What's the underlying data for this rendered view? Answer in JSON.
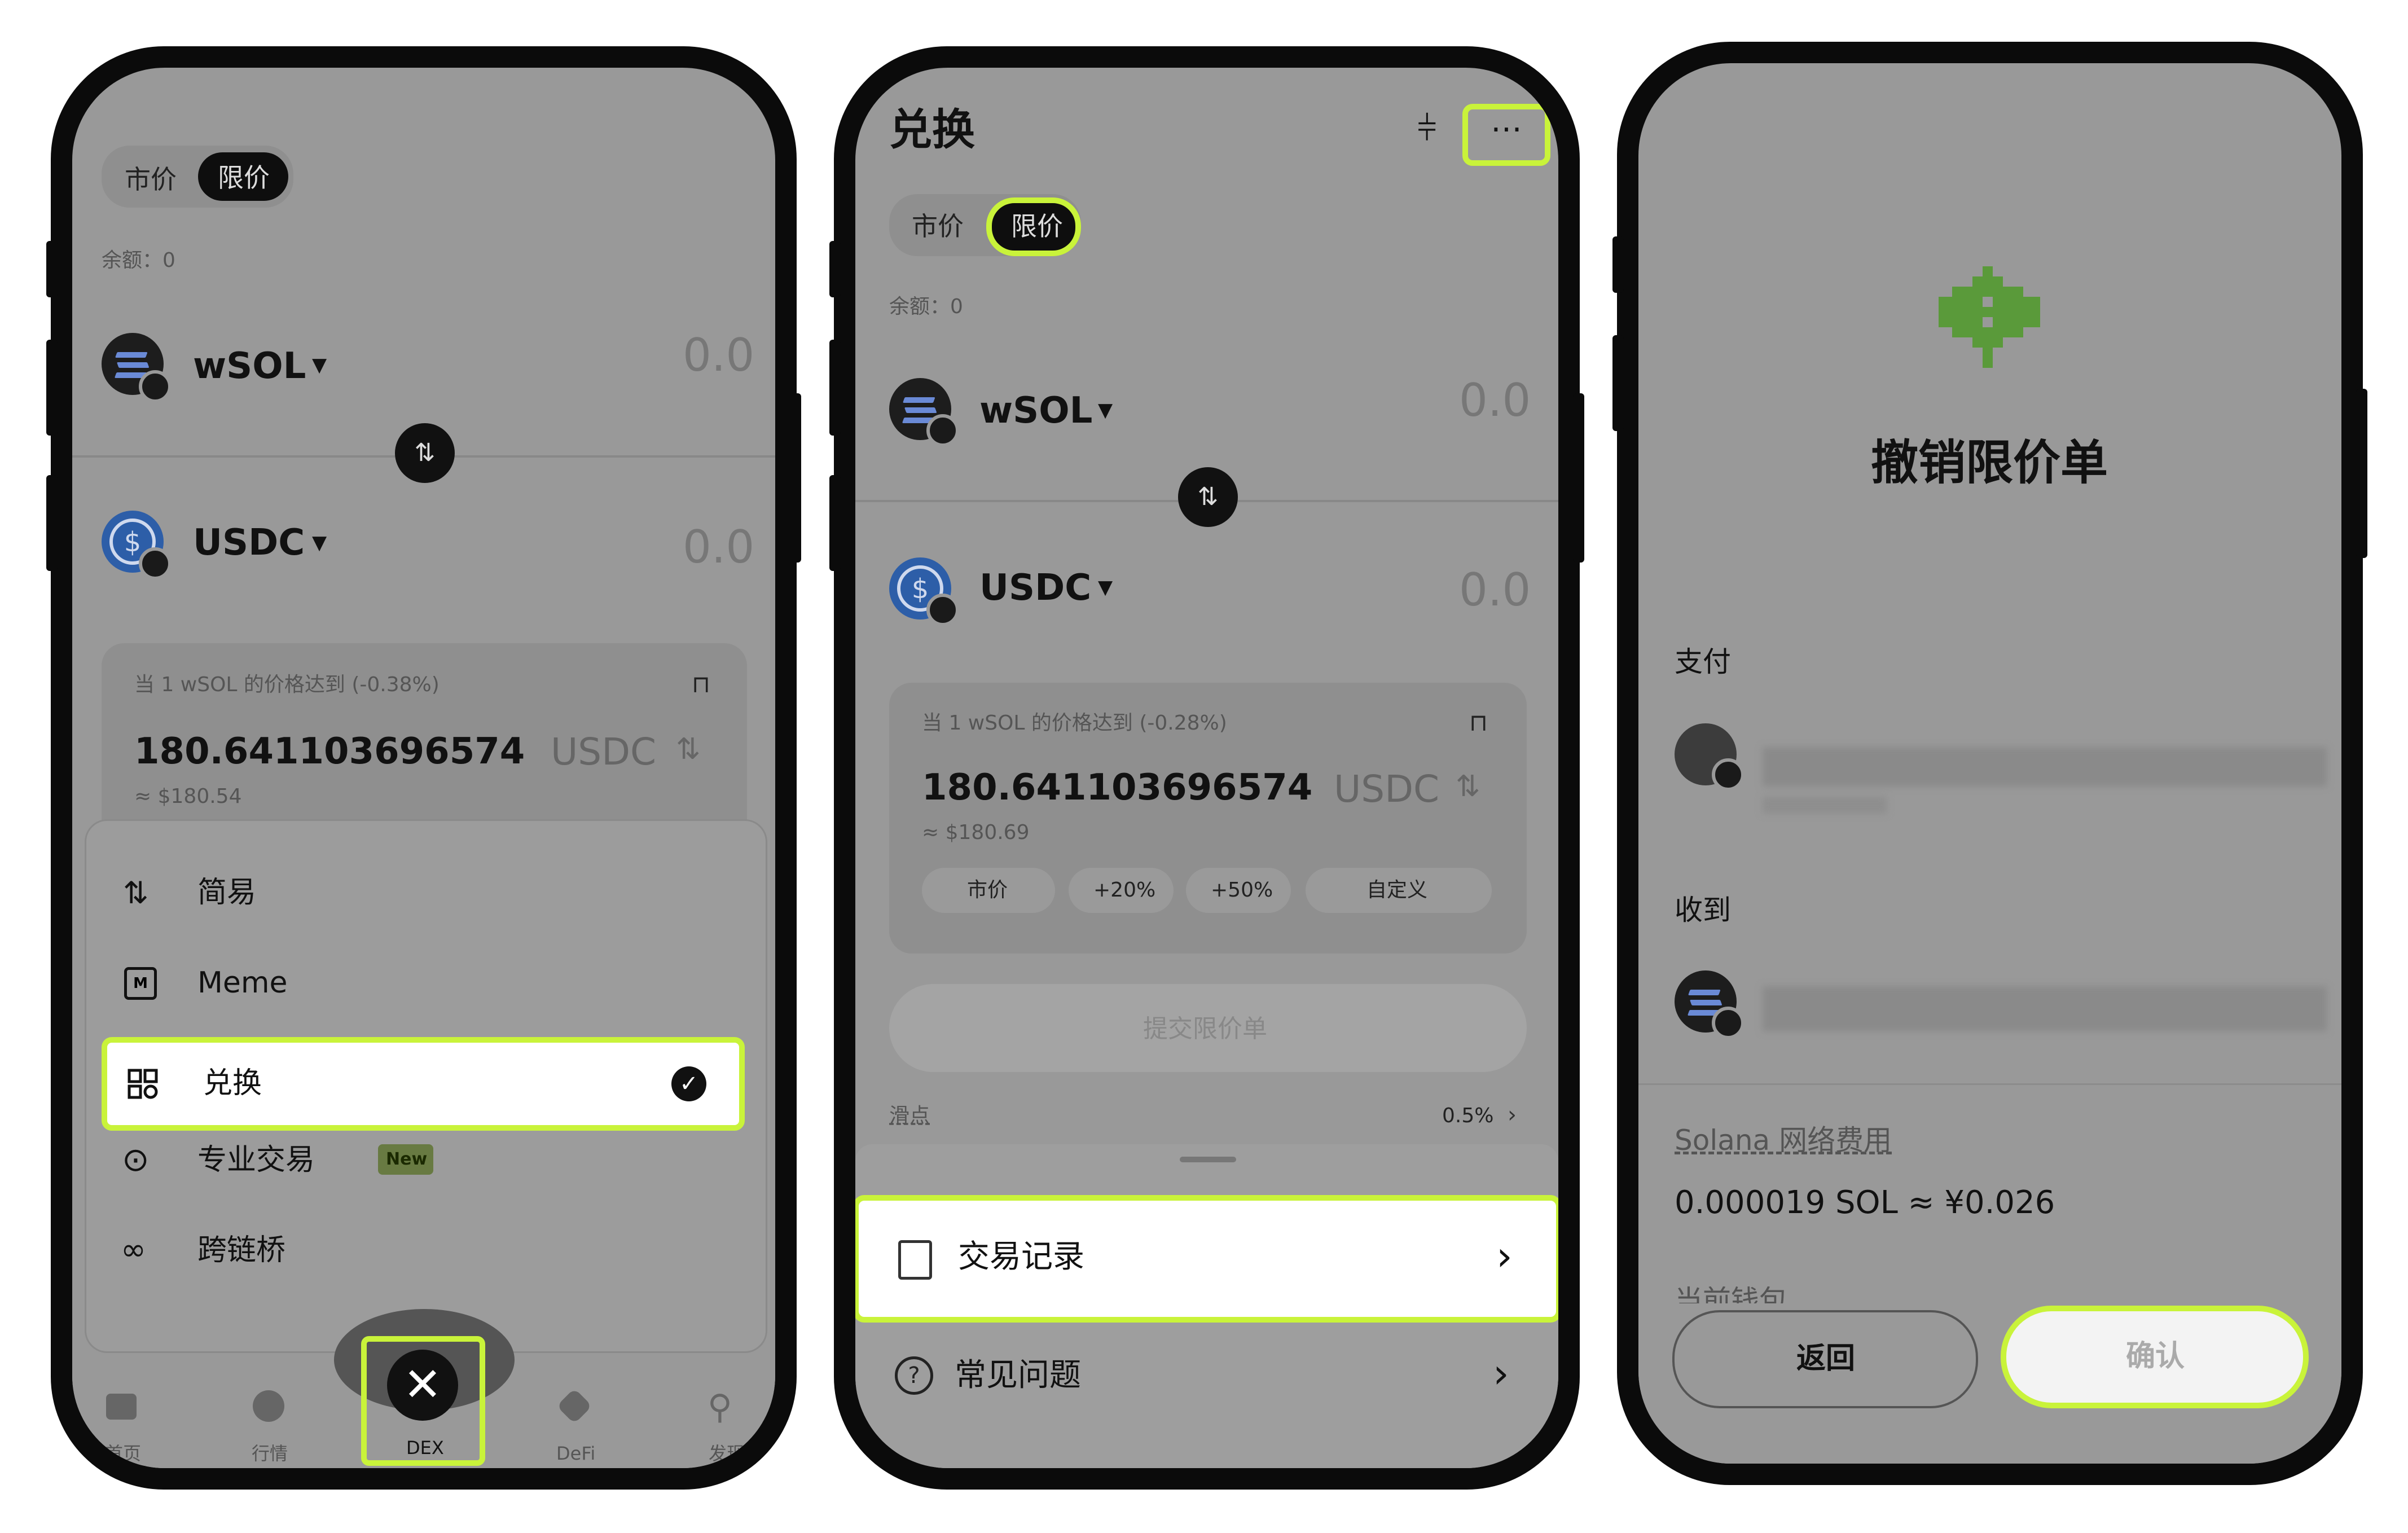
{
  "phone1": {
    "tabs": [
      "市价",
      "限价"
    ],
    "balance": "余额：0",
    "from_token": {
      "symbol": "wSOL",
      "amount": "0.0"
    },
    "to_token": {
      "symbol": "USDC",
      "amount": "0.0"
    },
    "price_condition": "当 1 wSOL 的价格达到 (-0.38%)",
    "price_value": "180.641103696574",
    "price_unit": "USDC",
    "price_fiat": "≈ $180.54",
    "menu": [
      {
        "icon": "simple-arrows-icon",
        "label": "简易"
      },
      {
        "icon": "meme-icon",
        "label": "Meme"
      },
      {
        "icon": "swap-icon",
        "label": "兑换",
        "selected": true
      },
      {
        "icon": "pro-trade-icon",
        "label": "专业交易",
        "badge": "New"
      },
      {
        "icon": "bridge-icon",
        "label": "跨链桥"
      }
    ],
    "nav": [
      {
        "icon": "wallet-icon",
        "label": "首页"
      },
      {
        "icon": "market-icon",
        "label": "行情"
      },
      {
        "icon": "close-icon",
        "label": "DEX",
        "active": true
      },
      {
        "icon": "defi-icon",
        "label": "DeFi"
      },
      {
        "icon": "telescope-icon",
        "label": "发现"
      }
    ]
  },
  "phone2": {
    "title": "兑换",
    "tabs": [
      "市价",
      "限价"
    ],
    "balance": "余额：0",
    "from_token": {
      "symbol": "wSOL",
      "amount": "0.0"
    },
    "to_token": {
      "symbol": "USDC",
      "amount": "0.0"
    },
    "price_condition": "当 1 wSOL 的价格达到 (-0.28%)",
    "price_value": "180.641103696574",
    "price_unit": "USDC",
    "price_fiat": "≈ $180.69",
    "quick_chips": [
      "市价",
      "+20%",
      "+50%",
      "自定义"
    ],
    "submit_label": "提交限价单",
    "slippage_label": "滑点",
    "slippage_value": "0.5%",
    "sheet_items": [
      {
        "icon": "history-icon",
        "label": "交易记录",
        "highlighted": true
      },
      {
        "icon": "help-icon",
        "label": "常见问题"
      }
    ]
  },
  "phone3": {
    "title": "撤销限价单",
    "pay_label": "支付",
    "receive_label": "收到",
    "fee_label": "Solana 网络费用",
    "fee_value": "0.000019 SOL ≈ ¥0.026",
    "wallet_label": "当前钱包",
    "back_label": "返回",
    "confirm_label": "确认"
  },
  "colors": {
    "highlight": "#c9f33a",
    "screen_overlay": "#999999",
    "phone_frame": "#0b0b0b",
    "pixel_logo": "#5a9a3a"
  }
}
